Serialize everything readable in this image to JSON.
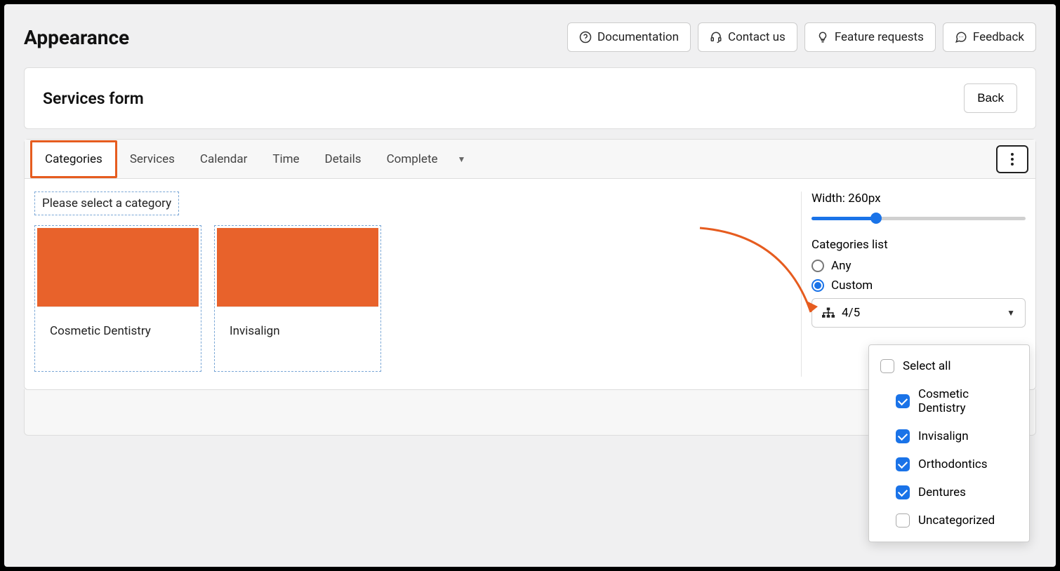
{
  "page_title": "Appearance",
  "top_links": {
    "documentation": "Documentation",
    "contact": "Contact us",
    "feature": "Feature requests",
    "feedback": "Feedback"
  },
  "card": {
    "title": "Services form",
    "back": "Back"
  },
  "tabs": {
    "categories": "Categories",
    "services": "Services",
    "calendar": "Calendar",
    "time": "Time",
    "details": "Details",
    "complete": "Complete"
  },
  "prompt": "Please select a category",
  "category_cards": {
    "c1": "Cosmetic Dentistry",
    "c2": "Invisalign"
  },
  "sidebar": {
    "width_label": "Width: 260px",
    "categories_list_label": "Categories list",
    "radio_any": "Any",
    "radio_custom": "Custom",
    "select_value": "4/5"
  },
  "dropdown": {
    "select_all": "Select all",
    "opt1": "Cosmetic Dentistry",
    "opt2": "Invisalign",
    "opt3": "Orthodontics",
    "opt4": "Dentures",
    "opt5": "Uncategorized"
  }
}
